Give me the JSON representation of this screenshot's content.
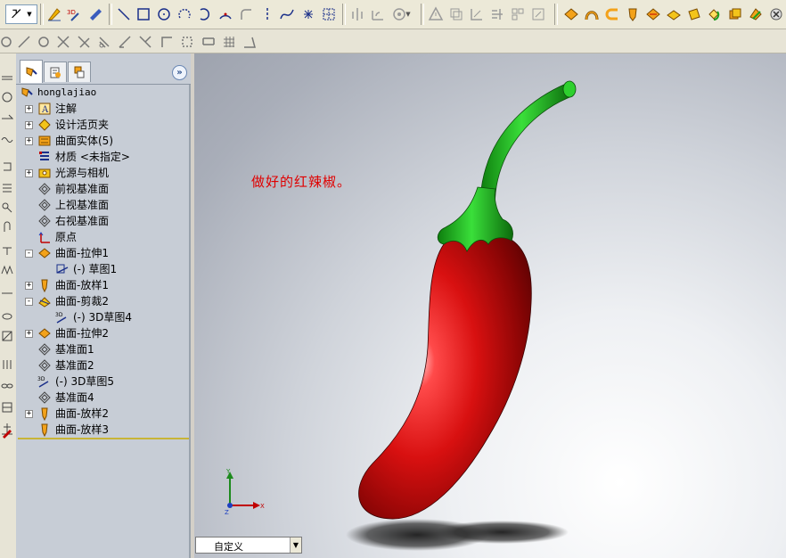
{
  "toolbar_top": {
    "icons": [
      "zoom-icon",
      "dropdown-arrow-icon",
      "sketch-icon",
      "3d-sketch-icon",
      "smart-dimension-icon",
      "line-icon",
      "rectangle-icon",
      "circle-icon",
      "centerpoint-arc-icon",
      "tangent-arc-icon",
      "three-point-arc-icon",
      "sketch-fillet-icon",
      "centerline-icon",
      "spline-icon",
      "point-icon",
      "construction-grid-icon",
      "mirror-icon",
      "offset-icon",
      "convert-entities-icon",
      "trim-icon",
      "linear-pattern-icon",
      "relations-icon",
      "repair-icon",
      "extrude-icon",
      "revolve-icon",
      "sweep-icon",
      "loft-icon",
      "boundary-icon",
      "fill-icon",
      "knit-icon",
      "thicken-icon",
      "delete-face-icon",
      "move-face-icon"
    ]
  },
  "toolbar_second": {
    "icons": [
      "construction-point-icon",
      "construction-line-icon",
      "cross-icon",
      "tangent-icon",
      "parallel-icon",
      "perpendicular-icon",
      "angle-icon",
      "dimension-icon",
      "grid-icon",
      "measure-icon"
    ]
  },
  "feature_manager": {
    "tabs": [
      "feature-manager-tab",
      "property-manager-tab",
      "configuration-manager-tab"
    ],
    "collapse_label": "»",
    "root": {
      "label": "honglajiao",
      "icon": "part-icon"
    },
    "items": [
      {
        "label": "注解",
        "icon": "annotations-icon",
        "expander": "+"
      },
      {
        "label": "设计活页夹",
        "icon": "design-binder-icon",
        "expander": "+"
      },
      {
        "label": "曲面实体(5)",
        "icon": "surface-bodies-icon",
        "expander": "+"
      },
      {
        "label": "材质 <未指定>",
        "icon": "material-icon",
        "expander": ""
      },
      {
        "label": "光源与相机",
        "icon": "lights-cameras-icon",
        "expander": "+"
      },
      {
        "label": "前视基准面",
        "icon": "plane-icon",
        "expander": ""
      },
      {
        "label": "上视基准面",
        "icon": "plane-icon",
        "expander": ""
      },
      {
        "label": "右视基准面",
        "icon": "plane-icon",
        "expander": ""
      },
      {
        "label": "原点",
        "icon": "origin-icon",
        "expander": ""
      },
      {
        "label": "曲面-拉伸1",
        "icon": "surface-extrude-icon",
        "expander": "-"
      },
      {
        "label": "(-) 草图1",
        "icon": "sketch-icon",
        "expander": "",
        "indent": 1
      },
      {
        "label": "曲面-放样1",
        "icon": "surface-loft-icon",
        "expander": "+"
      },
      {
        "label": "曲面-剪裁2",
        "icon": "surface-trim-icon",
        "expander": "-"
      },
      {
        "label": "(-) 3D草图4",
        "icon": "3d-sketch-icon",
        "expander": "",
        "indent": 1
      },
      {
        "label": "曲面-拉伸2",
        "icon": "surface-extrude-icon",
        "expander": "+"
      },
      {
        "label": "基准面1",
        "icon": "plane-icon",
        "expander": ""
      },
      {
        "label": "基准面2",
        "icon": "plane-icon",
        "expander": ""
      },
      {
        "label": "(-) 3D草图5",
        "icon": "3d-sketch-icon",
        "expander": ""
      },
      {
        "label": "基准面4",
        "icon": "plane-icon",
        "expander": ""
      },
      {
        "label": "曲面-放样2",
        "icon": "surface-loft-icon",
        "expander": "+"
      },
      {
        "label": "曲面-放样3",
        "icon": "surface-loft-icon",
        "expander": ""
      }
    ]
  },
  "viewport": {
    "annotation": "做好的红辣椒。",
    "triad": {
      "x": "X",
      "y": "Y",
      "z": "Z"
    },
    "config_combo": {
      "value": "自定义",
      "arrow": "▼"
    }
  },
  "colors": {
    "pepper_red": "#d81010",
    "stem_green": "#1fb81f",
    "annotation_red": "#e00000",
    "panel_bg": "#c7cdd6"
  }
}
